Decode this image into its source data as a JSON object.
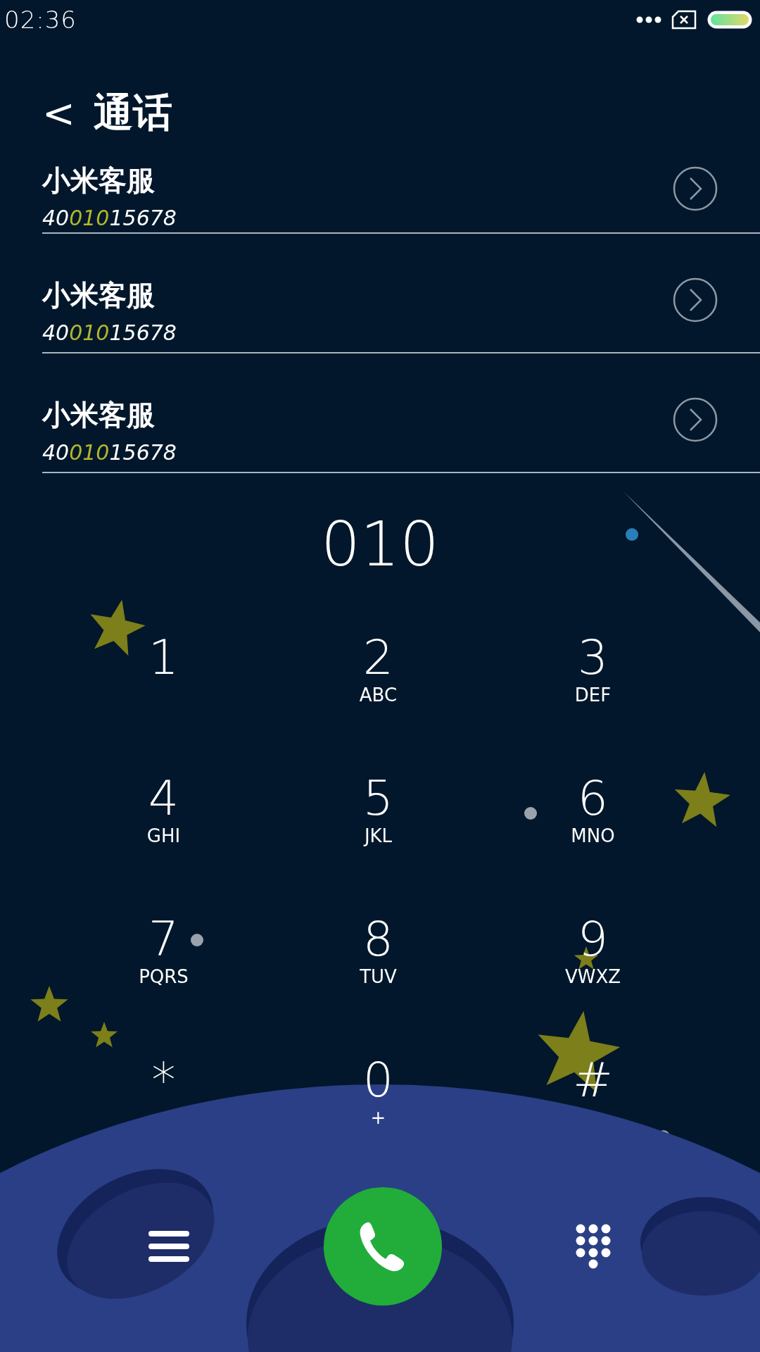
{
  "status_bar": {
    "time": "02:36"
  },
  "header": {
    "back": "<",
    "title": "通话"
  },
  "results": [
    {
      "name": "小米客服",
      "number_parts": [
        {
          "text": "40",
          "match": false
        },
        {
          "text": "010",
          "match": true
        },
        {
          "text": "15678",
          "match": false
        }
      ]
    },
    {
      "name": "小米客服",
      "number_parts": [
        {
          "text": "40",
          "match": false
        },
        {
          "text": "010",
          "match": true
        },
        {
          "text": "15678",
          "match": false
        }
      ]
    },
    {
      "name": "小米客服",
      "number_parts": [
        {
          "text": "40",
          "match": false
        },
        {
          "text": "010",
          "match": true
        },
        {
          "text": "15678",
          "match": false
        }
      ]
    }
  ],
  "dialed": "010",
  "keys": [
    {
      "digit": "1"
    },
    {
      "digit": "2",
      "letters": "ABC"
    },
    {
      "digit": "3",
      "letters": "DEF"
    },
    {
      "digit": "4",
      "letters": "GHI"
    },
    {
      "digit": "5",
      "letters": "JKL"
    },
    {
      "digit": "6",
      "letters": "MNO"
    },
    {
      "digit": "7",
      "letters": "PQRS"
    },
    {
      "digit": "8",
      "letters": "TUV"
    },
    {
      "digit": "9",
      "letters": "VWXZ"
    },
    {
      "digit": "*"
    },
    {
      "digit": "0",
      "letters": "+"
    },
    {
      "digit": "#"
    }
  ]
}
